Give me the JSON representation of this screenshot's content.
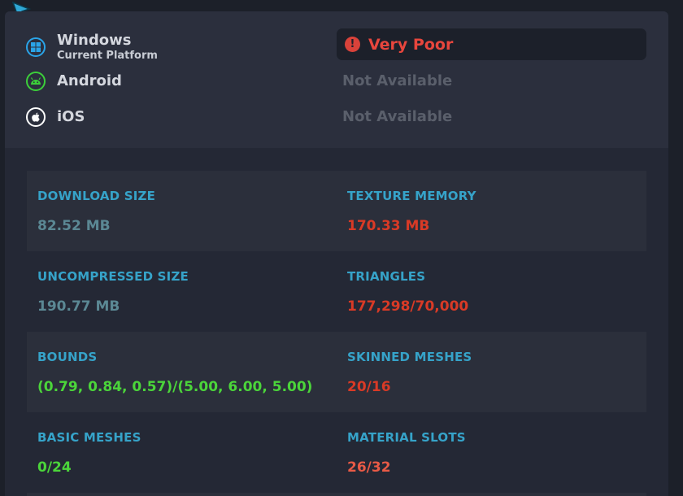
{
  "platforms": [
    {
      "name": "Windows",
      "subtitle": "Current Platform",
      "icon": "windows-icon",
      "color": "#2aa4e8"
    },
    {
      "name": "Android",
      "subtitle": "",
      "icon": "android-icon",
      "color": "#3ccf3a"
    },
    {
      "name": "iOS",
      "subtitle": "",
      "icon": "apple-icon",
      "color": "#ffffff"
    }
  ],
  "status": {
    "windows": "Very Poor",
    "android": "Not Available",
    "ios": "Not Available",
    "icon": "warning-icon",
    "color": "#e8463d"
  },
  "stats": [
    {
      "left": {
        "label": "DOWNLOAD SIZE",
        "value": "82.52 MB",
        "tone": "neutral"
      },
      "right": {
        "label": "TEXTURE MEMORY",
        "value": "170.33 MB",
        "tone": "red"
      }
    },
    {
      "left": {
        "label": "UNCOMPRESSED SIZE",
        "value": "190.77 MB",
        "tone": "neutral"
      },
      "right": {
        "label": "TRIANGLES",
        "value": "177,298/70,000",
        "tone": "red"
      }
    },
    {
      "left": {
        "label": "BOUNDS",
        "value": "(0.79, 0.84, 0.57)/(5.00, 6.00, 5.00)",
        "tone": "green"
      },
      "right": {
        "label": "SKINNED MESHES",
        "value": "20/16",
        "tone": "red"
      }
    },
    {
      "left": {
        "label": "BASIC MESHES",
        "value": "0/24",
        "tone": "green"
      },
      "right": {
        "label": "MATERIAL SLOTS",
        "value": "26/32",
        "tone": "salmon"
      }
    }
  ],
  "colors": {
    "label": "#36a3c9",
    "neutral": "#5b8894",
    "red": "#d93a26",
    "green": "#4bd53a",
    "salmon": "#e85a46"
  }
}
